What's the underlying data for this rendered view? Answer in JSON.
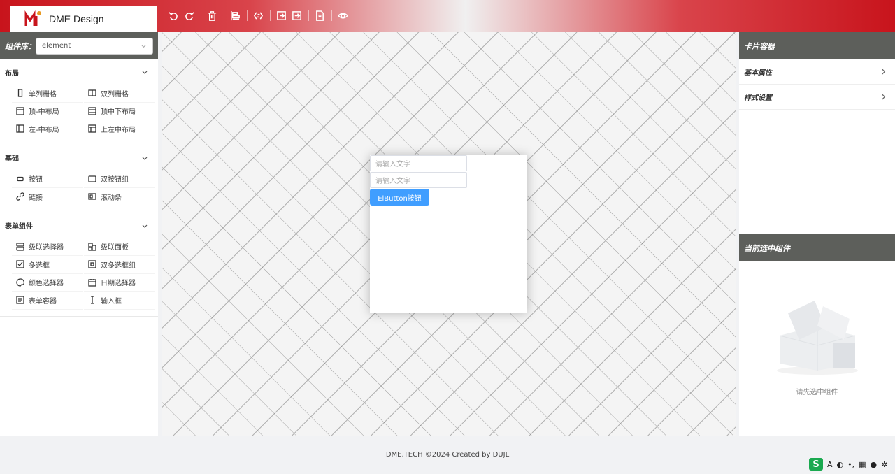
{
  "header": {
    "logo_text": "DME Design",
    "toolbar": [
      "undo-icon",
      "redo-icon",
      "delete-icon",
      "align-icon",
      "code-icon",
      "import-icon",
      "export-icon",
      "file-icon",
      "preview-icon"
    ]
  },
  "left": {
    "lib_label": "组件库：",
    "lib_value": "element",
    "groups": [
      {
        "title": "布局",
        "items": [
          "单列栅格",
          "双列栅格",
          "顶-中布局",
          "顶中下布局",
          "左-中布局",
          "上左中布局"
        ]
      },
      {
        "title": "基础",
        "items": [
          "按钮",
          "双按钮组",
          "链接",
          "滚动条"
        ]
      },
      {
        "title": "表单组件",
        "items": [
          "级联选择器",
          "级联面板",
          "多选框",
          "双多选框组",
          "颜色选择器",
          "日期选择器",
          "表单容器",
          "输入框"
        ]
      }
    ]
  },
  "canvas": {
    "input1_placeholder": "请输入文字",
    "input2_placeholder": "请输入文字",
    "button_label": "ElButton按钮"
  },
  "right": {
    "panel_title": "卡片容器",
    "rows": [
      "基本属性",
      "样式设置"
    ],
    "selected_title": "当前选中组件",
    "empty_text": "请先选中组件"
  },
  "footer": {
    "text": "DME.TECH ©2024 Created by DUJL"
  },
  "ime": {
    "label": "S",
    "mode": "A"
  },
  "colors": {
    "brand_red": "#c8141c",
    "panel_header": "#5d5f5b",
    "primary": "#409eff"
  }
}
